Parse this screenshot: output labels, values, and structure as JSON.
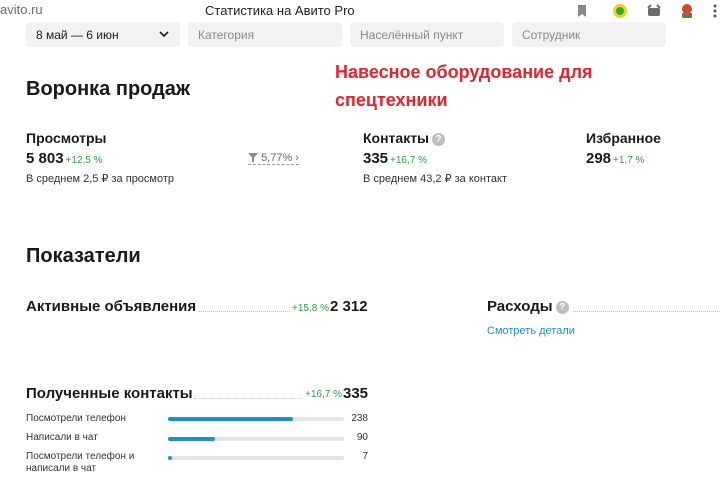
{
  "browser": {
    "url": "avito.ru",
    "tab_title": "Статистика на Авито Pro"
  },
  "filters": {
    "date_range": "8 май — 6 июн",
    "category_placeholder": "Категория",
    "city_placeholder": "Населённый пункт",
    "employee_placeholder": "Сотрудник"
  },
  "annotation": {
    "line1": "Навесное оборудование для",
    "line2": "спецтехники"
  },
  "funnel": {
    "title": "Воронка продаж",
    "views": {
      "label": "Просмотры",
      "value": "5 803",
      "delta": "+12,5 %",
      "note": "В среднем 2,5 ₽ за просмотр"
    },
    "conversion": "5,77% ›",
    "contacts": {
      "label": "Контакты",
      "value": "335",
      "delta": "+16,7 %",
      "note": "В среднем 43,2 ₽ за контакт"
    },
    "favorites": {
      "label": "Избранное",
      "value": "298",
      "delta": "+1,7 %"
    }
  },
  "indicators": {
    "title": "Показатели",
    "active_ads": {
      "label": "Активные объявления",
      "delta": "+15,8 %",
      "value": "2 312"
    },
    "expenses": {
      "label": "Расходы",
      "link": "Смотреть детали"
    },
    "received_contacts": {
      "label": "Полученные контакты",
      "delta": "+16,7 %",
      "value": "335",
      "max": 335,
      "breakdown": [
        {
          "label": "Посмотрели телефон",
          "value": 238
        },
        {
          "label": "Написали в чат",
          "value": 90
        },
        {
          "label": "Посмотрели телефон и написали в чат",
          "value": 7
        }
      ]
    }
  },
  "colors": {
    "accent_blue": "#1a8fd6",
    "positive_green": "#2e9e45",
    "annotation_red": "#e8212c"
  }
}
